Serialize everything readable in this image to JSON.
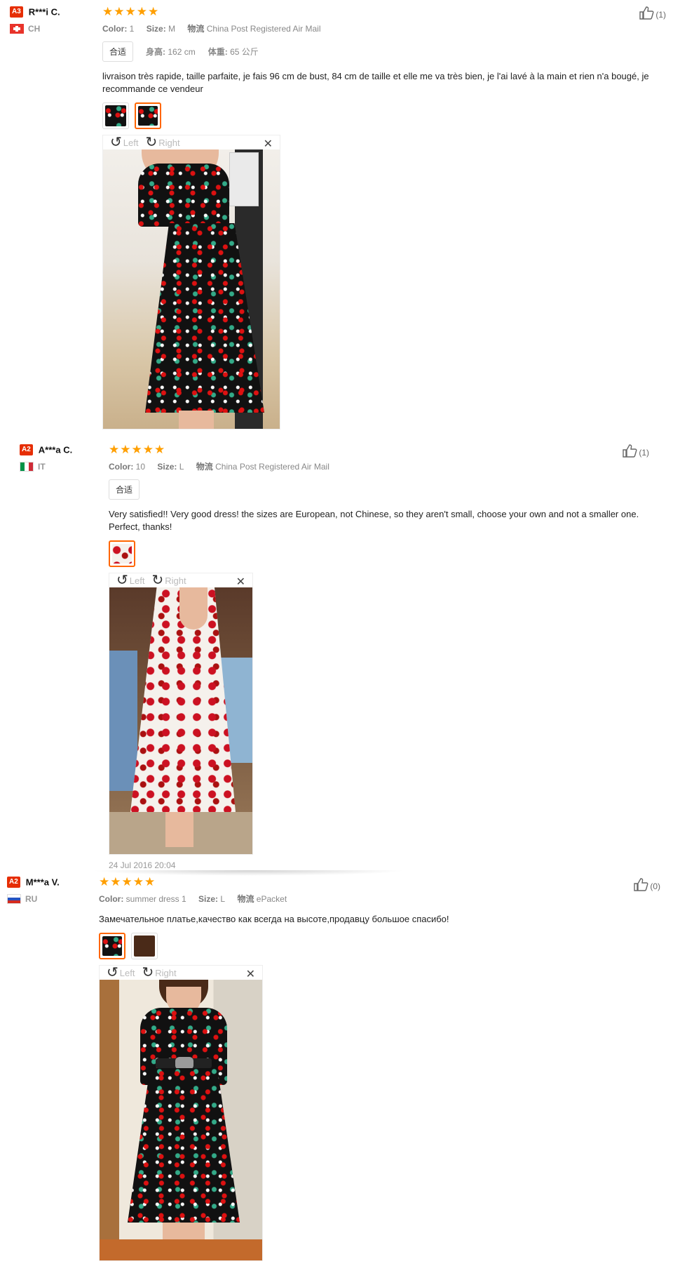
{
  "reviews": [
    {
      "badge": "A3",
      "user": "R***i C.",
      "country": "CH",
      "flag": "switzerland-flag",
      "stars": "★★★★★",
      "color_label": "Color:",
      "color_value": "1",
      "size_label": "Size:",
      "size_value": "M",
      "ship_label": "物流",
      "ship_value": "China Post Registered Air Mail",
      "fit_tag": "合适",
      "height_label": "身高:",
      "height_value": "162 cm",
      "weight_label": "体重:",
      "weight_value": "65 公斤",
      "text": "livraison très rapide, taille parfaite, je fais 96 cm de bust, 84 cm de taille et elle me va très bien, je l'ai lavé à la main et rien n'a bougé, je recommande ce vendeur",
      "likes": "(1)",
      "rotate_left": "Left",
      "rotate_right": "Right"
    },
    {
      "badge": "A2",
      "user": "A***a C.",
      "country": "IT",
      "flag": "italy-flag",
      "stars": "★★★★★",
      "color_label": "Color:",
      "color_value": "10",
      "size_label": "Size:",
      "size_value": "L",
      "ship_label": "物流",
      "ship_value": "China Post Registered Air Mail",
      "fit_tag": "合适",
      "text": "Very satisfied!! Very good dress! the sizes are European, not Chinese, so they aren't small, choose your own and not a smaller one. Perfect, thanks!",
      "likes": "(1)",
      "rotate_left": "Left",
      "rotate_right": "Right",
      "date": "24 Jul 2016 20:04"
    },
    {
      "badge": "A2",
      "user": "M***a V.",
      "country": "RU",
      "flag": "russia-flag",
      "stars": "★★★★★",
      "color_label": "Color:",
      "color_value": "summer dress 1",
      "size_label": "Size:",
      "size_value": "L",
      "ship_label": "物流",
      "ship_value": "ePacket",
      "text": "Замечательное платье,качество как всегда на высоте,продавцу большое спасибо!",
      "likes": "(0)",
      "rotate_left": "Left",
      "rotate_right": "Right"
    }
  ],
  "icons": {
    "rotate_left": "↺",
    "rotate_right": "↻",
    "close": "✕",
    "thumb_up": "👍"
  }
}
